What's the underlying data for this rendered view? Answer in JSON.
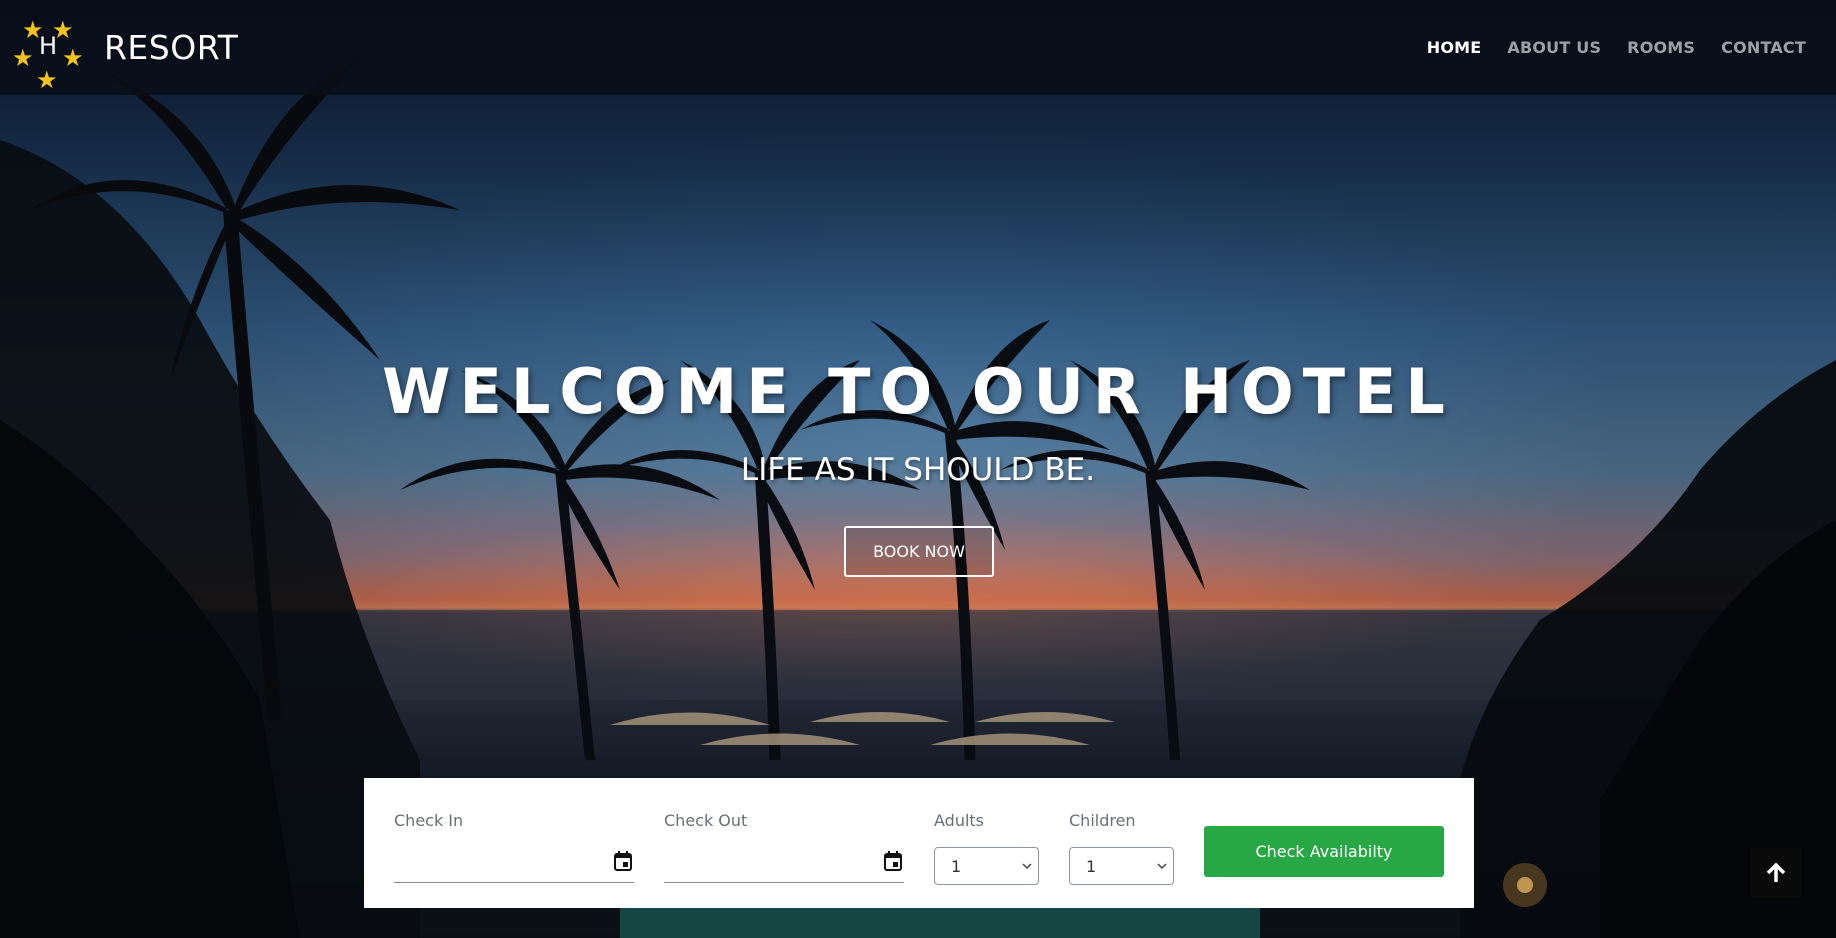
{
  "brand": {
    "logo_letter": "H",
    "name": "RESORT"
  },
  "nav": {
    "items": [
      {
        "label": "HOME",
        "active": true
      },
      {
        "label": "ABOUT US",
        "active": false
      },
      {
        "label": "ROOMS",
        "active": false
      },
      {
        "label": "CONTACT",
        "active": false
      }
    ]
  },
  "hero": {
    "title": "WELCOME TO OUR HOTEL",
    "subtitle": "LIFE AS IT SHOULD BE.",
    "cta_label": "BOOK NOW"
  },
  "booking": {
    "check_in": {
      "label": "Check In",
      "value": ""
    },
    "check_out": {
      "label": "Check Out",
      "value": ""
    },
    "adults": {
      "label": "Adults",
      "value": "1"
    },
    "children": {
      "label": "Children",
      "value": "1"
    },
    "submit_label": "Check Availabilty"
  },
  "icons": {
    "logo_star": "star-icon",
    "date": "calendar-icon",
    "select": "chevron-down-icon",
    "back_to_top": "arrow-up-icon"
  },
  "colors": {
    "accent_green": "#28a745",
    "star_yellow": "#f6c21c",
    "header_bg": "#080e18"
  }
}
